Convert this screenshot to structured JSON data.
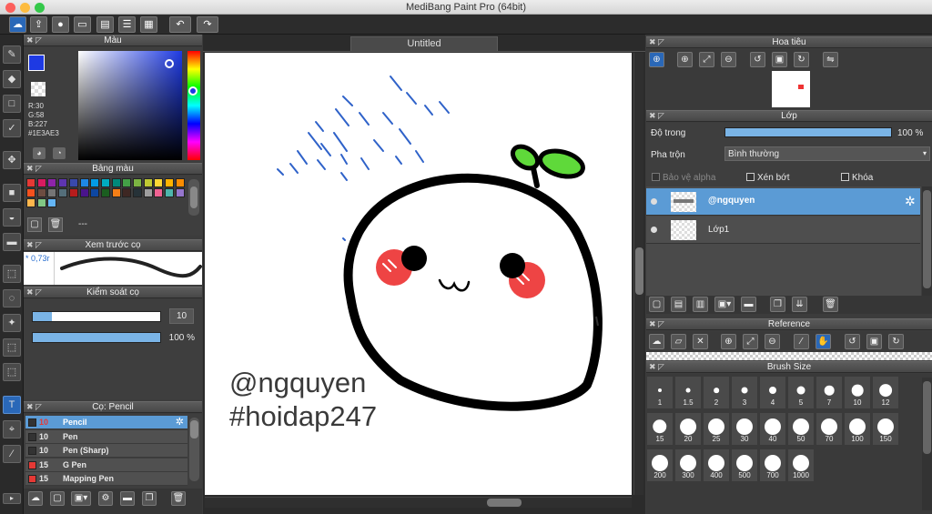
{
  "window": {
    "title": "MediBang Paint Pro (64bit)"
  },
  "toolbar": {
    "icons": [
      "cloud-icon",
      "share-icon",
      "chat-icon",
      "comment-icon",
      "page-icon",
      "list-icon",
      "grid-icon",
      "undo-icon",
      "redo-icon"
    ]
  },
  "tools": [
    "brush-icon",
    "eraser-icon",
    "rectangle-icon",
    "pen-icon",
    "move-icon",
    "fill-rect-icon",
    "bucket-icon",
    "gradient-icon",
    "select-icon",
    "lasso-icon",
    "magic-wand-icon",
    "select-pen-icon",
    "select-eraser-icon",
    "text-icon",
    "operation-icon",
    "eyedropper-icon"
  ],
  "color_panel": {
    "title": "Màu",
    "r": "R:30",
    "g": "G:58",
    "b": "B:227",
    "hex": "#1E3AE3",
    "current": "#1E3AE3"
  },
  "palette_panel": {
    "title": "Bảng màu",
    "name": "---",
    "swatches": [
      "#e53935",
      "#d81b60",
      "#8e24aa",
      "#5e35b1",
      "#3949ab",
      "#1e88e5",
      "#039be5",
      "#00acc1",
      "#00897b",
      "#43a047",
      "#7cb342",
      "#c0ca33",
      "#fdd835",
      "#ffb300",
      "#fb8c00",
      "#f4511e",
      "#6d4c41",
      "#757575",
      "#546e7a",
      "#b71c1c",
      "#4a148c",
      "#0d47a1",
      "#1b5e20",
      "#f57f17",
      "#3e2723",
      "#263238",
      "#9e9e9e",
      "#f06292",
      "#4db6ac",
      "#9575cd",
      "#ffb74d",
      "#81c784",
      "#64b5f6"
    ]
  },
  "brush_preview": {
    "title": "Xem trước cọ",
    "size": "* 0,73r"
  },
  "brush_control": {
    "title": "Kiểm soát cọ",
    "size_value": "10",
    "opacity_value": "100 %",
    "size_fraction": 0.15,
    "opacity_fraction": 1.0
  },
  "brush_list": {
    "title": "Cọ: Pencil",
    "items": [
      {
        "size": "10",
        "name": "Pencil",
        "color": "#333",
        "selected": true
      },
      {
        "size": "10",
        "name": "Pen",
        "color": "#333"
      },
      {
        "size": "10",
        "name": "Pen (Sharp)",
        "color": "#333"
      },
      {
        "size": "15",
        "name": "G Pen",
        "color": "#e53935"
      },
      {
        "size": "15",
        "name": "Mapping Pen",
        "color": "#e53935"
      }
    ]
  },
  "canvas": {
    "tab": "Untitled",
    "watermark_line1": "@ngquyen",
    "watermark_line2": "#hoidap247"
  },
  "navigator": {
    "title": "Hoa tiêu"
  },
  "layer_panel": {
    "title": "Lớp",
    "opacity_label": "Độ trong",
    "opacity_value": "100 %",
    "opacity_fraction": 1.0,
    "blend_label": "Pha trộn",
    "blend_value": "Bình thường",
    "protect_alpha": "Bảo vệ alpha",
    "clipping": "Xén bớt",
    "lock": "Khóa",
    "layers": [
      {
        "name": "@ngquyen",
        "selected": true
      },
      {
        "name": "Lớp1",
        "selected": false
      }
    ]
  },
  "reference_panel": {
    "title": "Reference"
  },
  "brush_size_panel": {
    "title": "Brush Size",
    "sizes": [
      "1",
      "1.5",
      "2",
      "3",
      "4",
      "5",
      "7",
      "10",
      "12",
      "15",
      "20",
      "25",
      "30",
      "40",
      "50",
      "70",
      "100",
      "150",
      "200",
      "300",
      "400",
      "500",
      "700",
      "1000"
    ]
  }
}
